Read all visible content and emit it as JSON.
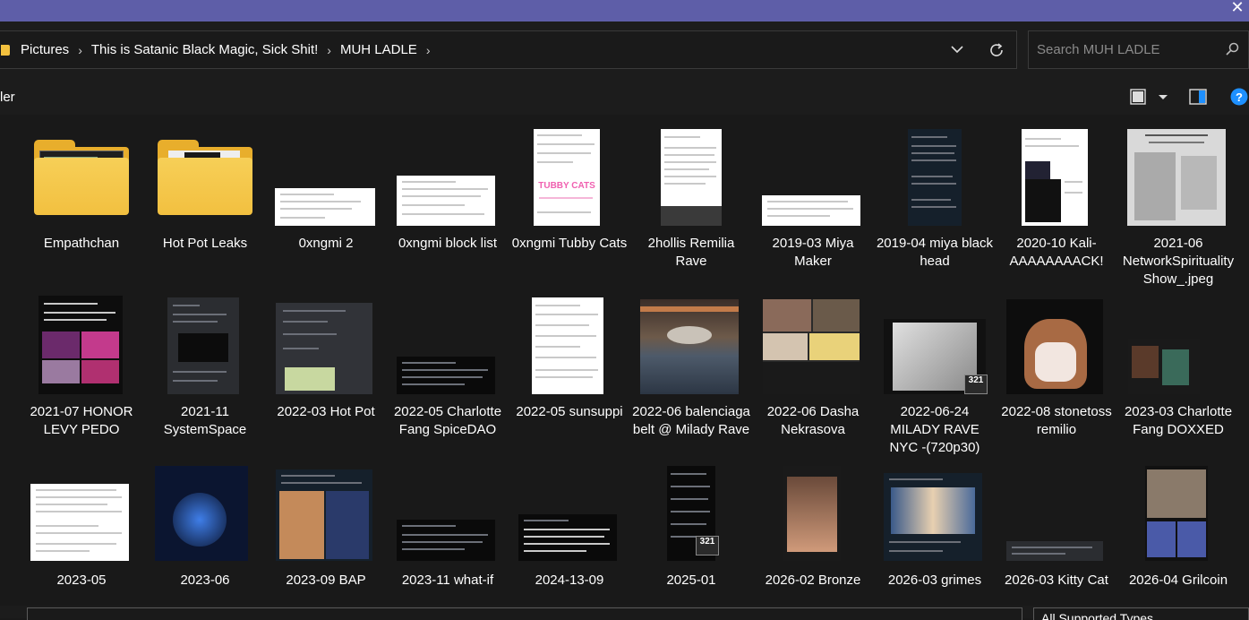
{
  "window": {
    "close_glyph": "✕"
  },
  "address": {
    "crumbs": [
      "Pictures",
      "This is Satanic Black Magic, Sick Shit!",
      "MUH LADLE"
    ],
    "separator": "›"
  },
  "search": {
    "placeholder": "Search MUH LADLE",
    "value": ""
  },
  "toolbar": {
    "partial_text": "ler",
    "help": "?"
  },
  "items": [
    {
      "label": "Empathchan",
      "kind": "folder"
    },
    {
      "label": "Hot Pot Leaks",
      "kind": "folder"
    },
    {
      "label": "0xngmi 2",
      "kind": "image"
    },
    {
      "label": "0xngmi block list",
      "kind": "image"
    },
    {
      "label": "0xngmi Tubby Cats",
      "kind": "image"
    },
    {
      "label": "2hollis Remilia Rave",
      "kind": "image"
    },
    {
      "label": "2019-03 Miya Maker",
      "kind": "image"
    },
    {
      "label": "2019-04 miya black head",
      "kind": "image"
    },
    {
      "label": "2020-10 Kali-AAAAAAAACK!",
      "kind": "image"
    },
    {
      "label": "2021-06 NetworkSpiritualityShow_.jpeg",
      "kind": "image"
    },
    {
      "label": "2021-07 HONOR LEVY PEDO",
      "kind": "image"
    },
    {
      "label": "2021-11 SystemSpace",
      "kind": "image"
    },
    {
      "label": "2022-03 Hot Pot",
      "kind": "image"
    },
    {
      "label": "2022-05 Charlotte Fang SpiceDAO",
      "kind": "image"
    },
    {
      "label": "2022-05 sunsuppi",
      "kind": "image"
    },
    {
      "label": "2022-06 balenciaga belt @ Milady Rave",
      "kind": "image"
    },
    {
      "label": "2022-06 Dasha Nekrasova",
      "kind": "image"
    },
    {
      "label": "2022-06-24 MILADY RAVE NYC -(720p30)",
      "kind": "video"
    },
    {
      "label": "2022-08 stonetoss remilio",
      "kind": "image"
    },
    {
      "label": "2023-03 Charlotte Fang DOXXED",
      "kind": "image"
    },
    {
      "label": "2023-05",
      "kind": "image"
    },
    {
      "label": "2023-06",
      "kind": "image"
    },
    {
      "label": "2023-09 BAP",
      "kind": "image"
    },
    {
      "label": "2023-11 what-if",
      "kind": "image"
    },
    {
      "label": "2024-13-09",
      "kind": "image"
    },
    {
      "label": "2025-01",
      "kind": "video"
    },
    {
      "label": "2026-02 Bronze",
      "kind": "image"
    },
    {
      "label": "2026-03 grimes",
      "kind": "image"
    },
    {
      "label": "2026-03 Kitty Cat",
      "kind": "image"
    },
    {
      "label": "2026-04 Grilcoin",
      "kind": "image"
    }
  ],
  "tubby_text": "TUBBY CATS",
  "video_badge": "321",
  "filetype": {
    "value": "All Supported Types"
  },
  "colors": {
    "titlebar": "#5e5ea8",
    "folder": "#f2c040",
    "background": "#191919",
    "accent": "#1e90ff"
  }
}
